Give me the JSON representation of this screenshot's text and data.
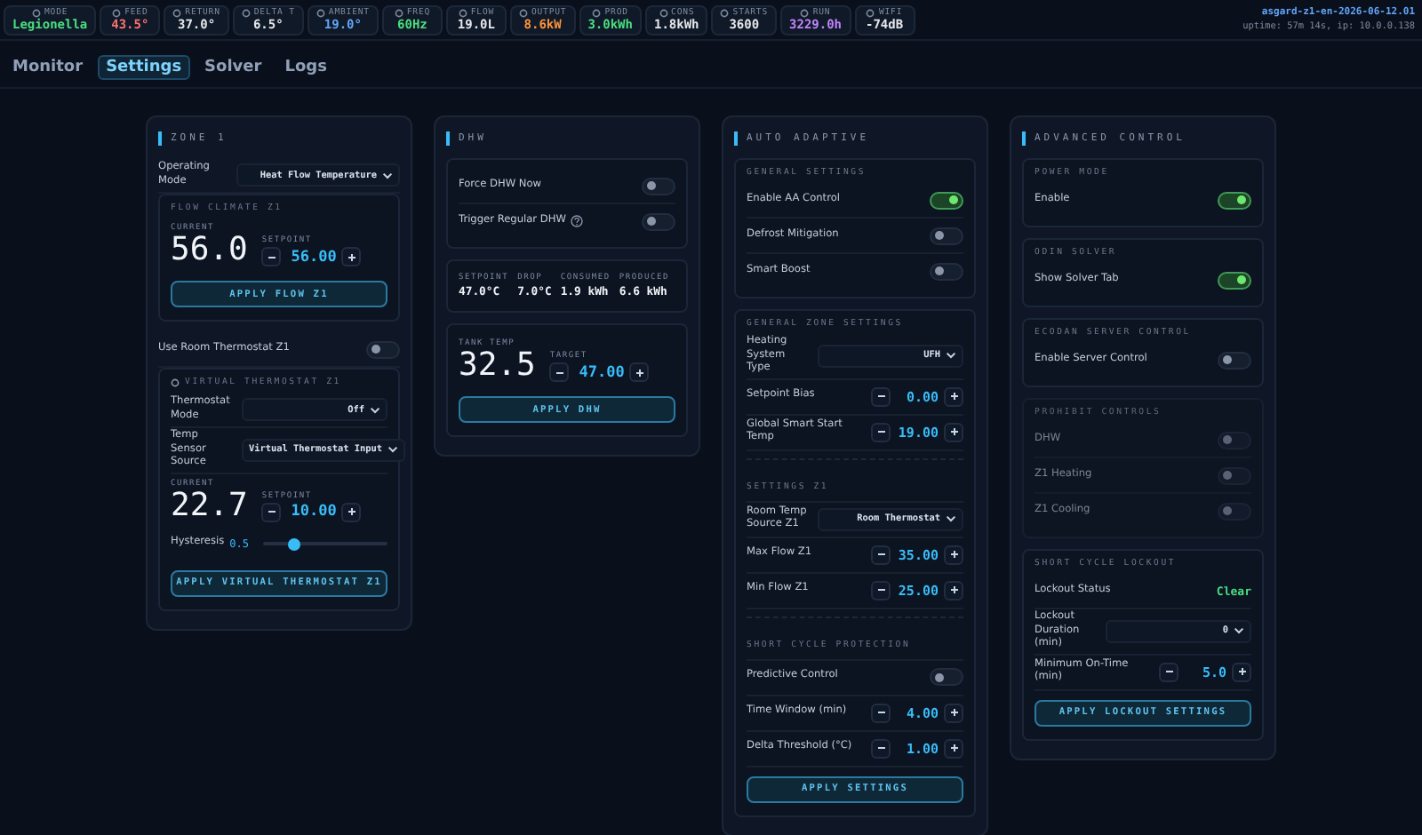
{
  "status_bar": {
    "chips": [
      {
        "label": "MODE",
        "value": "Legionella",
        "color": "#4ade80"
      },
      {
        "label": "FEED",
        "value": "43.5°",
        "color": "#f87171"
      },
      {
        "label": "RETURN",
        "value": "37.0°",
        "color": "#e5e7eb"
      },
      {
        "label": "DELTA T",
        "value": "6.5°",
        "color": "#e5e7eb"
      },
      {
        "label": "AMBIENT",
        "value": "19.0°",
        "color": "#60a5fa"
      },
      {
        "label": "FREQ",
        "value": "60Hz",
        "color": "#4ade80"
      },
      {
        "label": "FLOW",
        "value": "19.0L",
        "color": "#e5e7eb"
      },
      {
        "label": "OUTPUT",
        "value": "8.6kW",
        "color": "#fb923c"
      },
      {
        "label": "PROD",
        "value": "3.0kWh",
        "color": "#4ade80"
      },
      {
        "label": "CONS",
        "value": "1.8kWh",
        "color": "#e5e7eb"
      },
      {
        "label": "STARTS",
        "value": "3600",
        "color": "#e5e7eb"
      },
      {
        "label": "RUN",
        "value": "3229.0h",
        "color": "#c084fc"
      },
      {
        "label": "WIFI",
        "value": "-74dB",
        "color": "#e5e7eb"
      }
    ],
    "host": "asgard-z1-en-2026-06-12.01",
    "uptime": "uptime: 57m 14s, ip: 10.0.0.138"
  },
  "tabs": [
    {
      "label": "Monitor",
      "selected": false
    },
    {
      "label": "Settings",
      "selected": true
    },
    {
      "label": "Solver",
      "selected": false
    },
    {
      "label": "Logs",
      "selected": false
    }
  ],
  "columns": [
    {
      "title": "ZONE 1",
      "items": [
        {
          "kind": "select",
          "label": "Operating Mode",
          "value": "Heat Flow Temperature"
        },
        {
          "kind": "card",
          "title": "FLOW CLIMATE Z1",
          "disabled": false,
          "rows": [
            {
              "kind": "big",
              "current_label": "CURRENT",
              "current": "56.0",
              "setpoint_label": "SETPOINT",
              "setpoint": "56.00"
            },
            {
              "kind": "button",
              "label": "APPLY FLOW Z1"
            }
          ]
        },
        {
          "kind": "toggle",
          "label": "Use Room Thermostat Z1",
          "on": false
        },
        {
          "kind": "card",
          "title": "VIRTUAL THERMOSTAT Z1",
          "active": false,
          "disabled": false,
          "rows": [
            {
              "kind": "select",
              "label": "Thermostat Mode",
              "value": "Off"
            },
            {
              "kind": "select",
              "label": "Temp Sensor Source",
              "value": "Virtual Thermostat Input"
            },
            {
              "kind": "big",
              "current_label": "CURRENT",
              "current": "22.7",
              "setpoint_label": "SETPOINT",
              "setpoint": "10.00"
            },
            {
              "kind": "slider",
              "label": "Hysteresis",
              "value": "0.5",
              "level": 0.25
            },
            {
              "kind": "button",
              "label": "APPLY VIRTUAL THERMOSTAT Z1"
            }
          ]
        }
      ]
    },
    {
      "title": "DHW",
      "items": [
        {
          "kind": "card",
          "disabled": false,
          "rows": [
            {
              "kind": "toggle",
              "label": "Force DHW Now",
              "on": false
            },
            {
              "kind": "toggle",
              "label": "Trigger Regular DHW",
              "on": false,
              "help": true
            }
          ]
        },
        {
          "kind": "card",
          "disabled": false,
          "rows": [
            {
              "kind": "stats",
              "items": [
                {
                  "label": "SETPOINT",
                  "value": "47.0°C"
                },
                {
                  "label": "DROP",
                  "value": "7.0°C"
                },
                {
                  "label": "CONSUMED",
                  "value": "1.9 kWh"
                },
                {
                  "label": "PRODUCED",
                  "value": "6.6 kWh"
                }
              ]
            }
          ]
        },
        {
          "kind": "card",
          "disabled": false,
          "rows": [
            {
              "kind": "big",
              "current_label": "TANK TEMP",
              "current": "32.5",
              "setpoint_label": "TARGET",
              "setpoint": "47.00"
            },
            {
              "kind": "button",
              "label": "APPLY DHW"
            }
          ]
        }
      ]
    },
    {
      "title": "AUTO ADAPTIVE",
      "items": [
        {
          "kind": "card",
          "title": "GENERAL SETTINGS",
          "disabled": false,
          "rows": [
            {
              "kind": "toggle",
              "label": "Enable AA Control",
              "on": true
            },
            {
              "kind": "toggle",
              "label": "Defrost Mitigation",
              "on": false
            },
            {
              "kind": "toggle",
              "label": "Smart Boost",
              "on": false
            }
          ]
        },
        {
          "kind": "card",
          "title": "GENERAL ZONE SETTINGS",
          "disabled": false,
          "rows": [
            {
              "kind": "select",
              "label": "Heating System Type",
              "value": "UFH"
            },
            {
              "kind": "stepper",
              "label": "Setpoint Bias",
              "value": "0.00"
            },
            {
              "kind": "stepper",
              "label": "Global Smart Start Temp",
              "value": "19.00"
            },
            {
              "kind": "heading",
              "text": "SETTINGS Z1"
            },
            {
              "kind": "select",
              "label": "Room Temp Source Z1",
              "value": "Room Thermostat"
            },
            {
              "kind": "stepper",
              "label": "Max Flow Z1",
              "value": "35.00"
            },
            {
              "kind": "stepper",
              "label": "Min Flow Z1",
              "value": "25.00"
            },
            {
              "kind": "heading",
              "text": "SHORT CYCLE PROTECTION"
            },
            {
              "kind": "toggle",
              "label": "Predictive Control",
              "on": false
            },
            {
              "kind": "stepper",
              "label": "Time Window (min)",
              "value": "4.00"
            },
            {
              "kind": "stepper",
              "label": "Delta Threshold (°C)",
              "value": "1.00"
            },
            {
              "kind": "button",
              "label": "APPLY SETTINGS"
            }
          ]
        }
      ]
    },
    {
      "title": "ADVANCED CONTROL",
      "items": [
        {
          "kind": "card",
          "title": "POWER MODE",
          "disabled": false,
          "rows": [
            {
              "kind": "toggle",
              "label": "Enable",
              "on": true
            }
          ]
        },
        {
          "kind": "card",
          "title": "ODIN SOLVER",
          "disabled": false,
          "rows": [
            {
              "kind": "toggle",
              "label": "Show Solver Tab",
              "on": true
            }
          ]
        },
        {
          "kind": "card",
          "title": "ECODAN SERVER CONTROL",
          "disabled": false,
          "rows": [
            {
              "kind": "toggle",
              "label": "Enable Server Control",
              "on": false
            }
          ]
        },
        {
          "kind": "card",
          "title": "PROHIBIT CONTROLS",
          "disabled": true,
          "rows": [
            {
              "kind": "toggle",
              "label": "DHW",
              "on": false
            },
            {
              "kind": "toggle",
              "label": "Z1 Heating",
              "on": false
            },
            {
              "kind": "toggle",
              "label": "Z1 Cooling",
              "on": false
            }
          ]
        },
        {
          "kind": "card",
          "title": "SHORT CYCLE LOCKOUT",
          "disabled": false,
          "rows": [
            {
              "kind": "status",
              "label": "Lockout Status",
              "value": "Clear"
            },
            {
              "kind": "select",
              "label": "Lockout Duration (min)",
              "value": "0"
            },
            {
              "kind": "stepper",
              "label": "Minimum On-Time (min)",
              "value": "5.0"
            },
            {
              "kind": "button",
              "label": "APPLY LOCKOUT SETTINGS"
            }
          ]
        }
      ]
    }
  ]
}
